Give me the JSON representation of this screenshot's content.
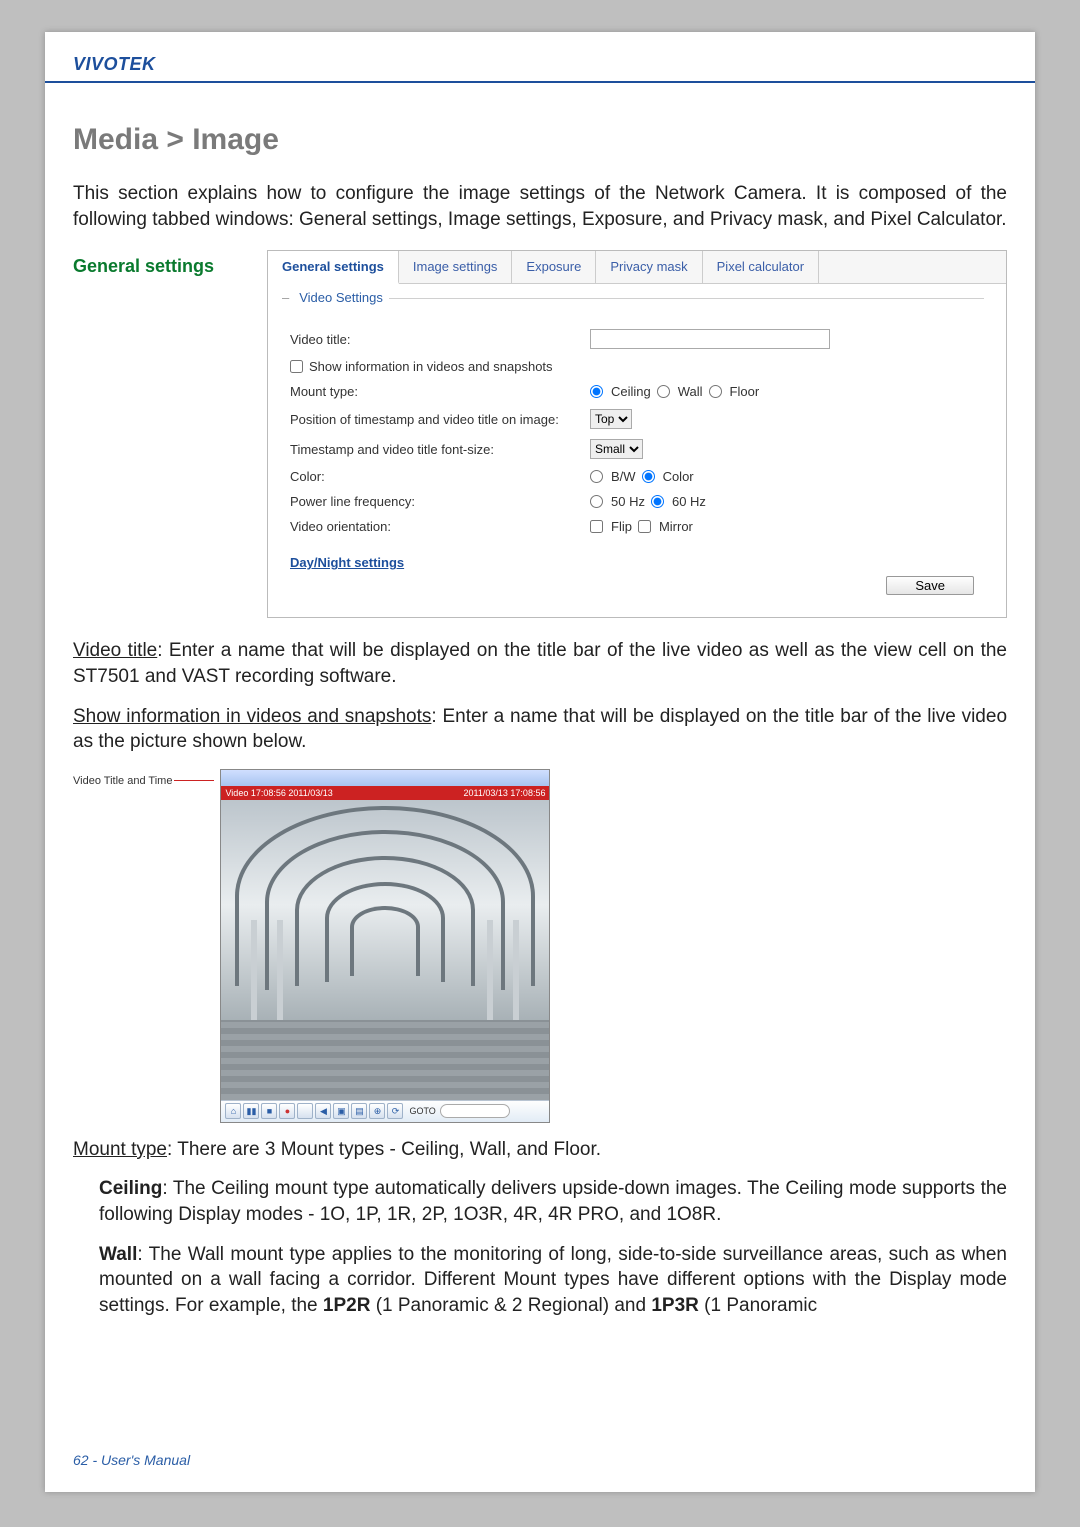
{
  "brand": "VIVOTEK",
  "section_title": "Media > Image",
  "intro": "This section explains how to configure the image settings of the Network Camera. It is composed of the following tabbed windows: General settings, Image settings, Exposure, and Privacy mask, and Pixel Calculator.",
  "left_heading": "General settings",
  "tabs": {
    "general": "General settings",
    "image": "Image settings",
    "exposure": "Exposure",
    "privacy": "Privacy mask",
    "pixel": "Pixel calculator"
  },
  "fieldset_minus": "–",
  "fieldset_title": "Video Settings",
  "labels": {
    "video_title": "Video title:",
    "show_info": "Show information in videos and snapshots",
    "mount_type": "Mount type:",
    "position": "Position of timestamp and video title on image:",
    "font_size": "Timestamp and video title font-size:",
    "color": "Color:",
    "power": "Power line frequency:",
    "orientation": "Video orientation:"
  },
  "options": {
    "mount_ceiling": "Ceiling",
    "mount_wall": "Wall",
    "mount_floor": "Floor",
    "pos_top": "Top",
    "font_small": "Small",
    "color_bw": "B/W",
    "color_color": "Color",
    "freq_50": "50 Hz",
    "freq_60": "60 Hz",
    "orient_flip": "Flip",
    "orient_mirror": "Mirror"
  },
  "day_night_link": "Day/Night settings",
  "save_label": "Save",
  "p_video_title_u": "Video title",
  "p_video_title_rest": ": Enter a name that will be displayed on the title bar of the live video as well as the view cell on the ST7501 and VAST recording software.",
  "p_show_u": "Show information in videos and snapshots",
  "p_show_rest": ": Enter a name that will be displayed on the title bar of the live video as the picture shown below.",
  "callout_label": "Video Title and Time",
  "player_top_left": "",
  "player_top_right": "",
  "titlebar_left": "Video 17:08:56 2011/03/13",
  "titlebar_right": "2011/03/13 17:08:56",
  "toolbar_goto": "GOTO",
  "p_mount_u": "Mount type",
  "p_mount_rest": ": There are 3 Mount types - Ceiling, Wall, and Floor.",
  "p_ceiling_b": "Ceiling",
  "p_ceiling_rest": ": The Ceiling mount type automatically delivers upside-down images. The Ceiling mode supports the following Display modes - 1O, 1P, 1R, 2P, 1O3R, 4R, 4R PRO, and 1O8R.",
  "p_wall_b": "Wall",
  "p_wall_rest": ": The Wall mount type applies to the monitoring of long, side-to-side surveillance areas, such as when mounted on a wall facing a corridor. Different Mount types have different options with the Display mode settings. For example, the ",
  "p_wall_b2": "1P2R",
  "p_wall_rest2": " (1 Panoramic & 2 Regional) and ",
  "p_wall_b3": "1P3R",
  "p_wall_rest3": " (1 Panoramic",
  "footer": "62 - User's Manual"
}
